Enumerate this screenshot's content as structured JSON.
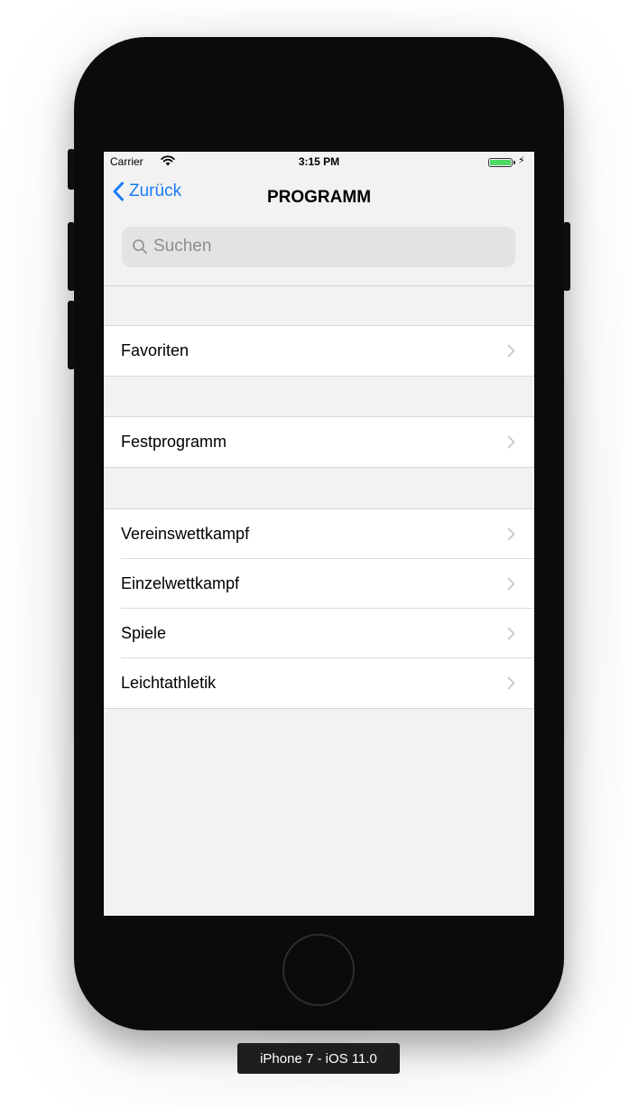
{
  "status_bar": {
    "carrier": "Carrier",
    "time": "3:15 PM",
    "battery_charging_icon": "bolt-icon",
    "battery_color": "#4cd964"
  },
  "nav": {
    "back_label": "Zurück",
    "title": "PROGRAMM",
    "accent_color": "#1a7cf5"
  },
  "search": {
    "placeholder": "Suchen",
    "icon": "search-icon"
  },
  "groups": [
    {
      "items": [
        {
          "label": "Favoriten"
        }
      ]
    },
    {
      "items": [
        {
          "label": "Festprogramm"
        }
      ]
    },
    {
      "items": [
        {
          "label": "Vereinswettkampf"
        },
        {
          "label": "Einzelwettkampf"
        },
        {
          "label": "Spiele"
        },
        {
          "label": "Leichtathletik"
        }
      ]
    }
  ],
  "device_label": "iPhone 7 - iOS 11.0"
}
